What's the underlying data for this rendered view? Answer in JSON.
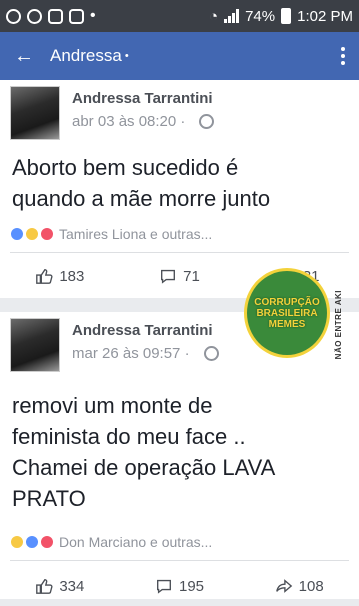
{
  "status_bar": {
    "battery": "74%",
    "time": "1:02 PM"
  },
  "app_bar": {
    "title": "Andressa",
    "dot": "•"
  },
  "posts": [
    {
      "author": "Andressa Tarrantini",
      "time": "abr 03 às 08:20 ·",
      "text": "Aborto bem sucedido é\nquando a mãe morre junto",
      "reactions_text": "Tamires Liona e outras...",
      "likes": "183",
      "comments": "71",
      "shares": "31"
    },
    {
      "author": "Andressa Tarrantini",
      "time": "mar 26 às 09:57 ·",
      "text": "removi um monte de\nfeminista do meu face ..\nChamei de operação LAVA\nPRATO",
      "reactions_text": "Don Marciano e outras...",
      "likes": "334",
      "comments": "195",
      "shares": "108"
    }
  ],
  "watermark": {
    "badge": "CORRUPÇÃO BRASILEIRA MEMES",
    "side": "NÃO ENTRE AKI"
  }
}
